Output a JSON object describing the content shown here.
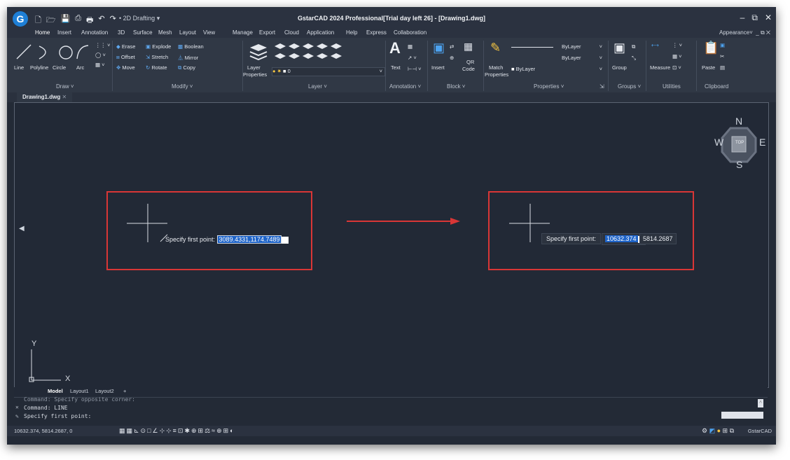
{
  "titlebar": {
    "logo": "G",
    "workspace": "2D Drafting",
    "title": "GstarCAD 2024 Professional[Trial day left 26] - [Drawing1.dwg]",
    "controls": [
      "_",
      "▭",
      "✕"
    ]
  },
  "tabs": [
    "Home",
    "Insert",
    "Annotation",
    "3D",
    "Surface",
    "Mesh",
    "Layout",
    "View",
    "Manage",
    "Export",
    "Cloud",
    "Application",
    "Help",
    "Express",
    "Collaboration"
  ],
  "appearance": "Appearance",
  "ribbon": {
    "draw": {
      "line": "Line",
      "polyline": "Polyline",
      "circle": "Circle",
      "arc": "Arc",
      "title": "Draw"
    },
    "modify": {
      "erase": "Erase",
      "explode": "Explode",
      "boolean": "Boolean",
      "offset": "Offset",
      "stretch": "Stretch",
      "mirror": "Mirror",
      "move": "Move",
      "rotate": "Rotate",
      "copy": "Copy",
      "title": "Modify"
    },
    "layer": {
      "properties_1": "Layer",
      "properties_2": "Properties",
      "current": "0",
      "title": "Layer"
    },
    "annotation": {
      "text": "Text",
      "title": "Annotation"
    },
    "block": {
      "insert": "Insert",
      "qr": "QR",
      "code": "Code",
      "title": "Block"
    },
    "properties": {
      "match_1": "Match",
      "match_2": "Properties",
      "bylayer_1": "ByLayer",
      "bylayer_2": "ByLayer",
      "bylayer_3": "ByLayer",
      "title": "Properties"
    },
    "groups": {
      "group": "Group",
      "title": "Groups"
    },
    "utilities": {
      "measure": "Measure",
      "title": "Utilities"
    },
    "clipboard": {
      "paste": "Paste",
      "title": "Clipboard"
    }
  },
  "document_tab": "Drawing1.dwg",
  "viewcube": {
    "n": "N",
    "s": "S",
    "e": "E",
    "w": "W",
    "face": "TOP"
  },
  "left_example": {
    "prompt": "Specify first point:",
    "value": "3089.4331,1174.7489"
  },
  "right_example": {
    "prompt": "Specify first point:",
    "x_value": "10632.374",
    "y_value": "5814.2687"
  },
  "model_tabs": [
    "Model",
    "Layout1",
    "Layout2",
    "+"
  ],
  "command_lines": [
    "Command: Specify opposite corner:",
    "Command: LINE",
    "Specify first point:"
  ],
  "coords": "10632.374, 5814.2687, 0",
  "status_right": "GstarCAD",
  "ucs": {
    "x": "X",
    "y": "Y"
  }
}
